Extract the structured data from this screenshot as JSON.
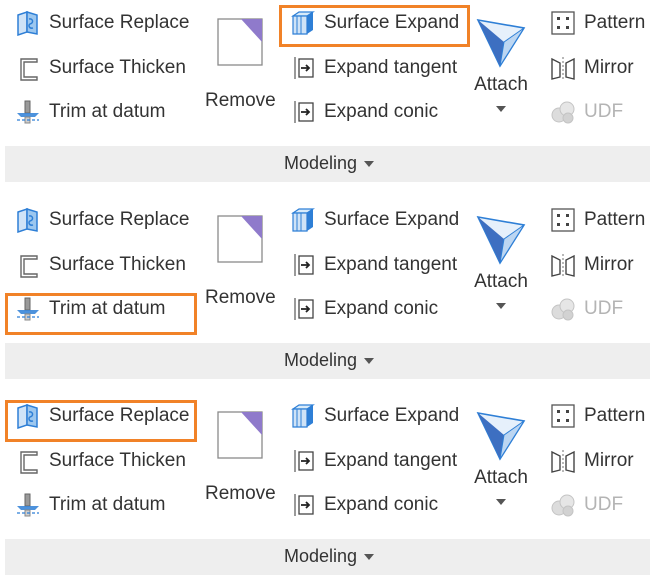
{
  "panels": [
    {
      "highlight": "Surface Expand",
      "buttons": {
        "surface_replace": "Surface Replace",
        "surface_thicken": "Surface Thicken",
        "trim_at_datum": "Trim at datum",
        "remove": "Remove",
        "surface_expand": "Surface Expand",
        "expand_tangent": "Expand tangent",
        "expand_conic": "Expand conic",
        "attach": "Attach",
        "pattern": "Pattern",
        "mirror": "Mirror",
        "udf": "UDF"
      },
      "group_label": "Modeling"
    },
    {
      "highlight": "Trim at datum",
      "buttons": {
        "surface_replace": "Surface Replace",
        "surface_thicken": "Surface Thicken",
        "trim_at_datum": "Trim at datum",
        "remove": "Remove",
        "surface_expand": "Surface Expand",
        "expand_tangent": "Expand tangent",
        "expand_conic": "Expand conic",
        "attach": "Attach",
        "pattern": "Pattern",
        "mirror": "Mirror",
        "udf": "UDF"
      },
      "group_label": "Modeling"
    },
    {
      "highlight": "Surface Replace",
      "buttons": {
        "surface_replace": "Surface Replace",
        "surface_thicken": "Surface Thicken",
        "trim_at_datum": "Trim at datum",
        "remove": "Remove",
        "surface_expand": "Surface Expand",
        "expand_tangent": "Expand tangent",
        "expand_conic": "Expand conic",
        "attach": "Attach",
        "pattern": "Pattern",
        "mirror": "Mirror",
        "udf": "UDF"
      },
      "group_label": "Modeling"
    }
  ],
  "colors": {
    "highlight": "#f18228",
    "icon_blue": "#2e7fd6",
    "icon_purple": "#7b5bbf",
    "disabled": "#b4b4b4",
    "footer_bg": "#eeeeee"
  },
  "icons": {
    "surface_replace": "surface-replace-icon",
    "surface_thicken": "surface-thicken-icon",
    "trim_at_datum": "trim-at-datum-icon",
    "remove": "remove-icon",
    "surface_expand": "surface-expand-icon",
    "expand_tangent": "expand-tangent-icon",
    "expand_conic": "expand-conic-icon",
    "attach": "attach-icon",
    "pattern": "pattern-icon",
    "mirror": "mirror-icon",
    "udf": "udf-icon",
    "dropdown": "chevron-down-icon"
  }
}
